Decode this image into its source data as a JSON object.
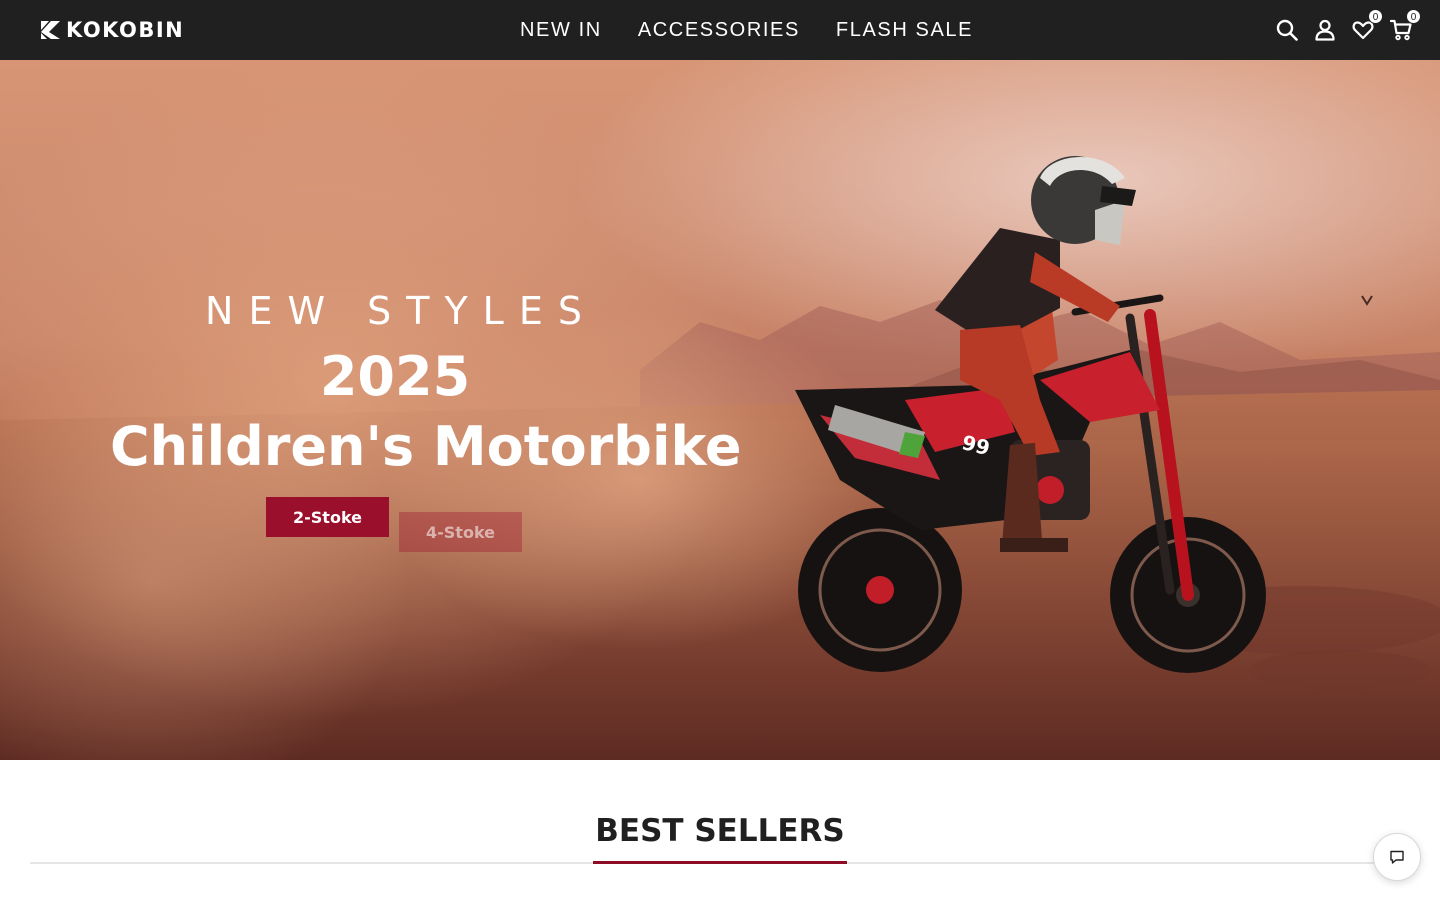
{
  "header": {
    "brand": "KOKOBIN",
    "nav": [
      {
        "label": "NEW IN"
      },
      {
        "label": "ACCESSORIES"
      },
      {
        "label": "FLASH SALE"
      }
    ],
    "icons": {
      "search": "search-icon",
      "account": "user-icon",
      "wishlist": "heart-icon",
      "cart": "cart-icon"
    },
    "wishlist_count": "0",
    "cart_count": "0"
  },
  "hero": {
    "eyebrow": "NEW STYLES",
    "year": "2025",
    "title": "Children's Motorbike",
    "primary_button": "2-Stoke",
    "secondary_button": "4-Stoke"
  },
  "best_sellers": {
    "title": "BEST SELLERS"
  },
  "chat": {
    "icon": "chat-bubble-icon"
  },
  "colors": {
    "header_bg": "#202020",
    "accent": "#9a0f2c",
    "title_underline": "#8f0d24"
  }
}
